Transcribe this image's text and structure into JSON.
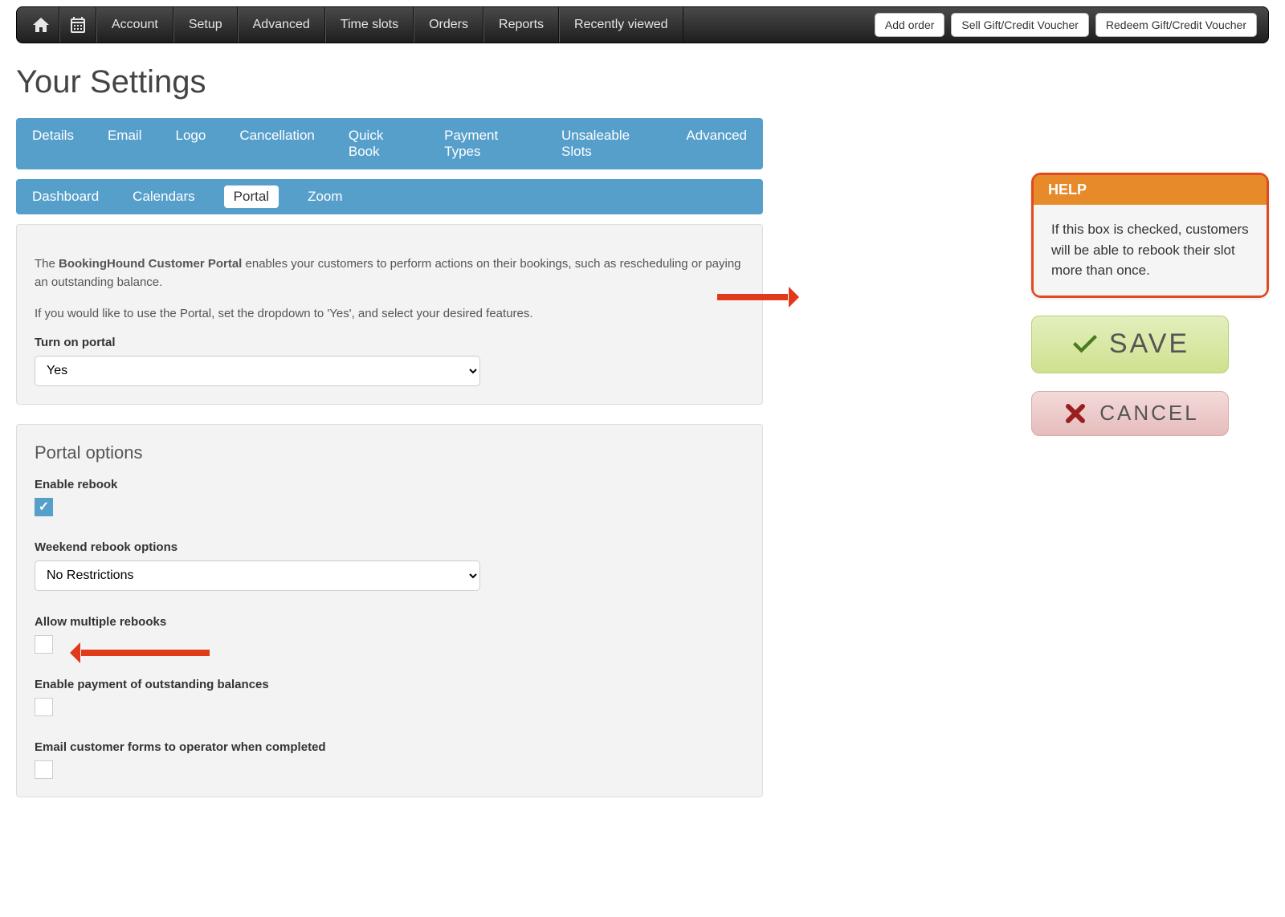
{
  "nav": {
    "items": [
      "Account",
      "Setup",
      "Advanced",
      "Time slots",
      "Orders",
      "Reports",
      "Recently viewed"
    ],
    "buttons": [
      "Add order",
      "Sell Gift/Credit Voucher",
      "Redeem Gift/Credit Voucher"
    ]
  },
  "page_title": "Your Settings",
  "tabs1": [
    "Details",
    "Email",
    "Logo",
    "Cancellation",
    "Quick Book",
    "Payment Types",
    "Unsaleable Slots",
    "Advanced"
  ],
  "tabs2": {
    "items": [
      "Dashboard",
      "Calendars",
      "Portal",
      "Zoom"
    ],
    "active": "Portal"
  },
  "intro": {
    "prefix": "The ",
    "bold": "BookingHound Customer Portal",
    "rest": " enables your customers to perform actions on their bookings, such as rescheduling or paying an outstanding balance.",
    "line2": "If you would like to use the Portal, set the dropdown to 'Yes', and select your desired features.",
    "turn_on_label": "Turn on portal",
    "turn_on_value": "Yes"
  },
  "options": {
    "heading": "Portal options",
    "enable_rebook_label": "Enable rebook",
    "enable_rebook_checked": true,
    "weekend_label": "Weekend rebook options",
    "weekend_value": "No Restrictions",
    "allow_multiple_label": "Allow multiple rebooks",
    "allow_multiple_checked": false,
    "enable_payment_label": "Enable payment of outstanding balances",
    "enable_payment_checked": false,
    "email_forms_label": "Email customer forms to operator when completed",
    "email_forms_checked": false
  },
  "help": {
    "title": "HELP",
    "body": "If this box is checked, customers will be able to rebook their slot more than once."
  },
  "buttons": {
    "save": "SAVE",
    "cancel": "CANCEL"
  }
}
